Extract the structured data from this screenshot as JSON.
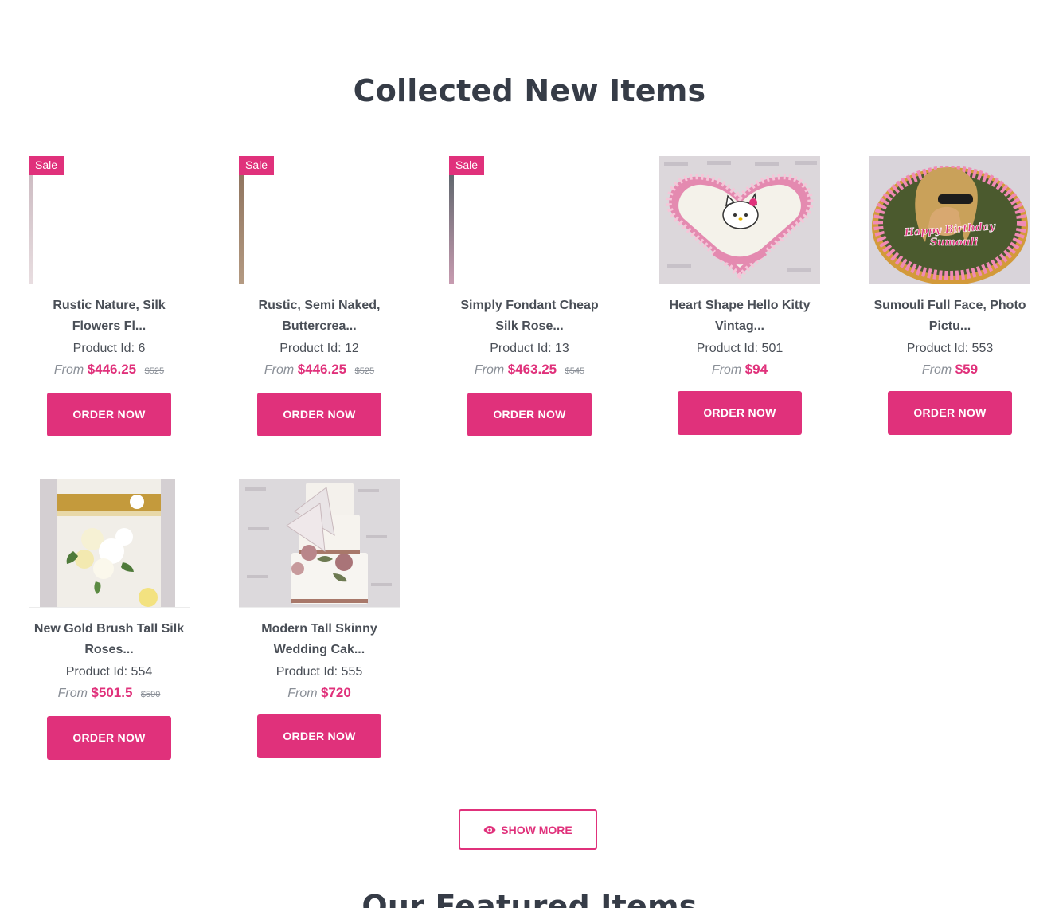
{
  "sections": {
    "new_items_title": "Collected New Items",
    "featured_title": "Our Featured Items"
  },
  "products": [
    {
      "name": "Rustic Nature, Silk Flowers Fl...",
      "id_label": "Product Id: 6",
      "from": "From",
      "price": "$446.25",
      "old_price": "$525",
      "badge": "Sale",
      "button": "ORDER NOW"
    },
    {
      "name": "Rustic, Semi Naked, Buttercrea...",
      "id_label": "Product Id: 12",
      "from": "From",
      "price": "$446.25",
      "old_price": "$525",
      "badge": "Sale",
      "button": "ORDER NOW"
    },
    {
      "name": "Simply Fondant Cheap Silk Rose...",
      "id_label": "Product Id: 13",
      "from": "From",
      "price": "$463.25",
      "old_price": "$545",
      "badge": "Sale",
      "button": "ORDER NOW"
    },
    {
      "name": "Heart Shape Hello Kitty Vintag...",
      "id_label": "Product Id: 501",
      "from": "From",
      "price": "$94",
      "button": "ORDER NOW"
    },
    {
      "name": "Sumouli Full Face, Photo Pictu...",
      "id_label": "Product Id: 553",
      "from": "From",
      "price": "$59",
      "button": "ORDER NOW",
      "image_text_line1": "Happy Birthday",
      "image_text_line2": "Sumouli"
    },
    {
      "name": "New Gold Brush Tall Silk Roses...",
      "id_label": "Product Id: 554",
      "from": "From",
      "price": "$501.5",
      "old_price": "$590",
      "button": "ORDER NOW"
    },
    {
      "name": "Modern Tall Skinny Wedding Cak...",
      "id_label": "Product Id: 555",
      "from": "From",
      "price": "$720",
      "button": "ORDER NOW"
    }
  ],
  "show_more": {
    "icon": "eye-icon",
    "label": "SHOW MORE"
  },
  "colors": {
    "accent": "#e0317b",
    "heading": "#363c47",
    "text": "#4a4f57",
    "muted": "#8a8f97"
  }
}
